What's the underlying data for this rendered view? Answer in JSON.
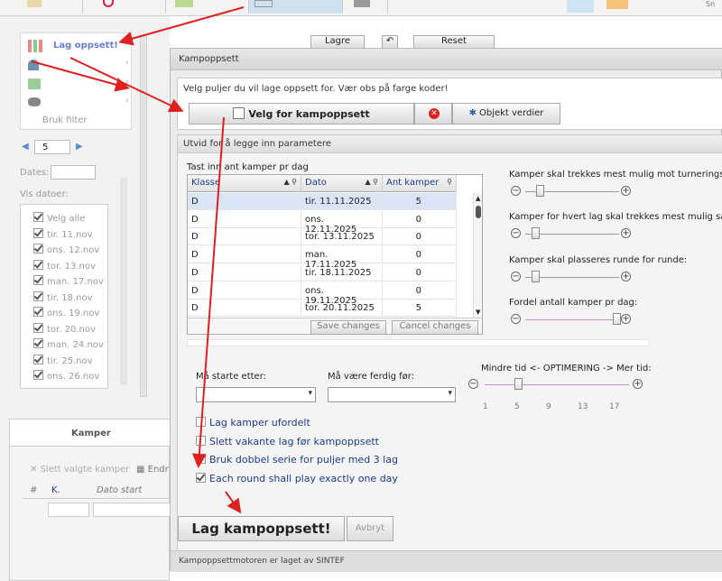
{
  "left": {
    "menu_items": [
      "Lag oppsett!",
      "",
      "",
      ""
    ],
    "bruk_filter": "Bruk filter",
    "pager_value": "5",
    "dates_label": "Dates:",
    "vis_datoer": "Vis datoer:",
    "date_items": [
      "Velg alle",
      "tir. 11.nov",
      "ons. 12.nov",
      "tor. 13.nov",
      "man. 17.nov",
      "tir. 18.nov",
      "ons. 19.nov",
      "tor. 20.nov",
      "man. 24.nov",
      "tir. 25.nov",
      "ons. 26.nov"
    ],
    "kamper_tab": "Kamper",
    "slett_valgte": "Slett valgte kamper",
    "endre": "Endr",
    "col_hash": "#",
    "col_k": "K.",
    "col_dato": "Dato start"
  },
  "toolbar": {
    "lagre": "Lagre",
    "reset": "Reset"
  },
  "dialog": {
    "title": "Kampoppsett",
    "instruction": "Velg puljer du vil lage oppsett for. Vær obs på farge koder!",
    "velg_btn": "Velg for kampoppsett",
    "objekt_btn": "Objekt verdier",
    "utvid": "Utvid for å legge inn parametere",
    "grid_caption": "Tast inn ant kamper pr dag",
    "grid_cols": [
      "Klasse",
      "Dato",
      "Ant kamper"
    ],
    "grid_rows": [
      [
        "D",
        "tir. 11.11.2025",
        "5"
      ],
      [
        "D",
        "ons. 12.11.2025",
        "0"
      ],
      [
        "D",
        "tor. 13.11.2025",
        "0"
      ],
      [
        "D",
        "man. 17.11.2025",
        "0"
      ],
      [
        "D",
        "tir. 18.11.2025",
        "0"
      ],
      [
        "D",
        "ons. 19.11.2025",
        "0"
      ],
      [
        "D",
        "tor. 20.11.2025",
        "5"
      ]
    ],
    "save_changes": "Save changes",
    "cancel_changes": "Cancel changes",
    "sliders": [
      {
        "label": "Kamper skal trekkes mest mulig mot turneringsstar",
        "level": 0.1
      },
      {
        "label": "Kamper for hvert lag skal trekkes mest mulig samm",
        "level": 0.05
      },
      {
        "label": "Kamper skal plasseres runde for runde:",
        "level": 0.05
      },
      {
        "label": "Fordel antall kamper pr dag:",
        "level": 0.97
      }
    ],
    "ma_starte": "Må starte etter:",
    "ma_vaere": "Må være ferdig før:",
    "optimering_label": "Mindre tid <- OPTIMERING -> Mer tid:",
    "optimering_level": 0.22,
    "optimering_ticks": [
      "1",
      "5",
      "9",
      "13",
      "17"
    ],
    "options": [
      {
        "label": "Lag kamper ufordelt",
        "checked": false
      },
      {
        "label": "Slett vakante lag før kampoppsett",
        "checked": false
      },
      {
        "label": "Bruk dobbel serie for puljer med 3 lag",
        "checked": false
      },
      {
        "label": "Each round shall play exactly one day",
        "checked": true
      }
    ],
    "lag_btn": "Lag kampoppsett!",
    "avbryt_btn": "Avbryt",
    "footer": "Kampoppsettmotoren er laget av SINTEF"
  },
  "colors": {
    "link_blue": "#1a3c8c",
    "arrow_red": "#e02020",
    "slider_track": "#c98fd0"
  }
}
